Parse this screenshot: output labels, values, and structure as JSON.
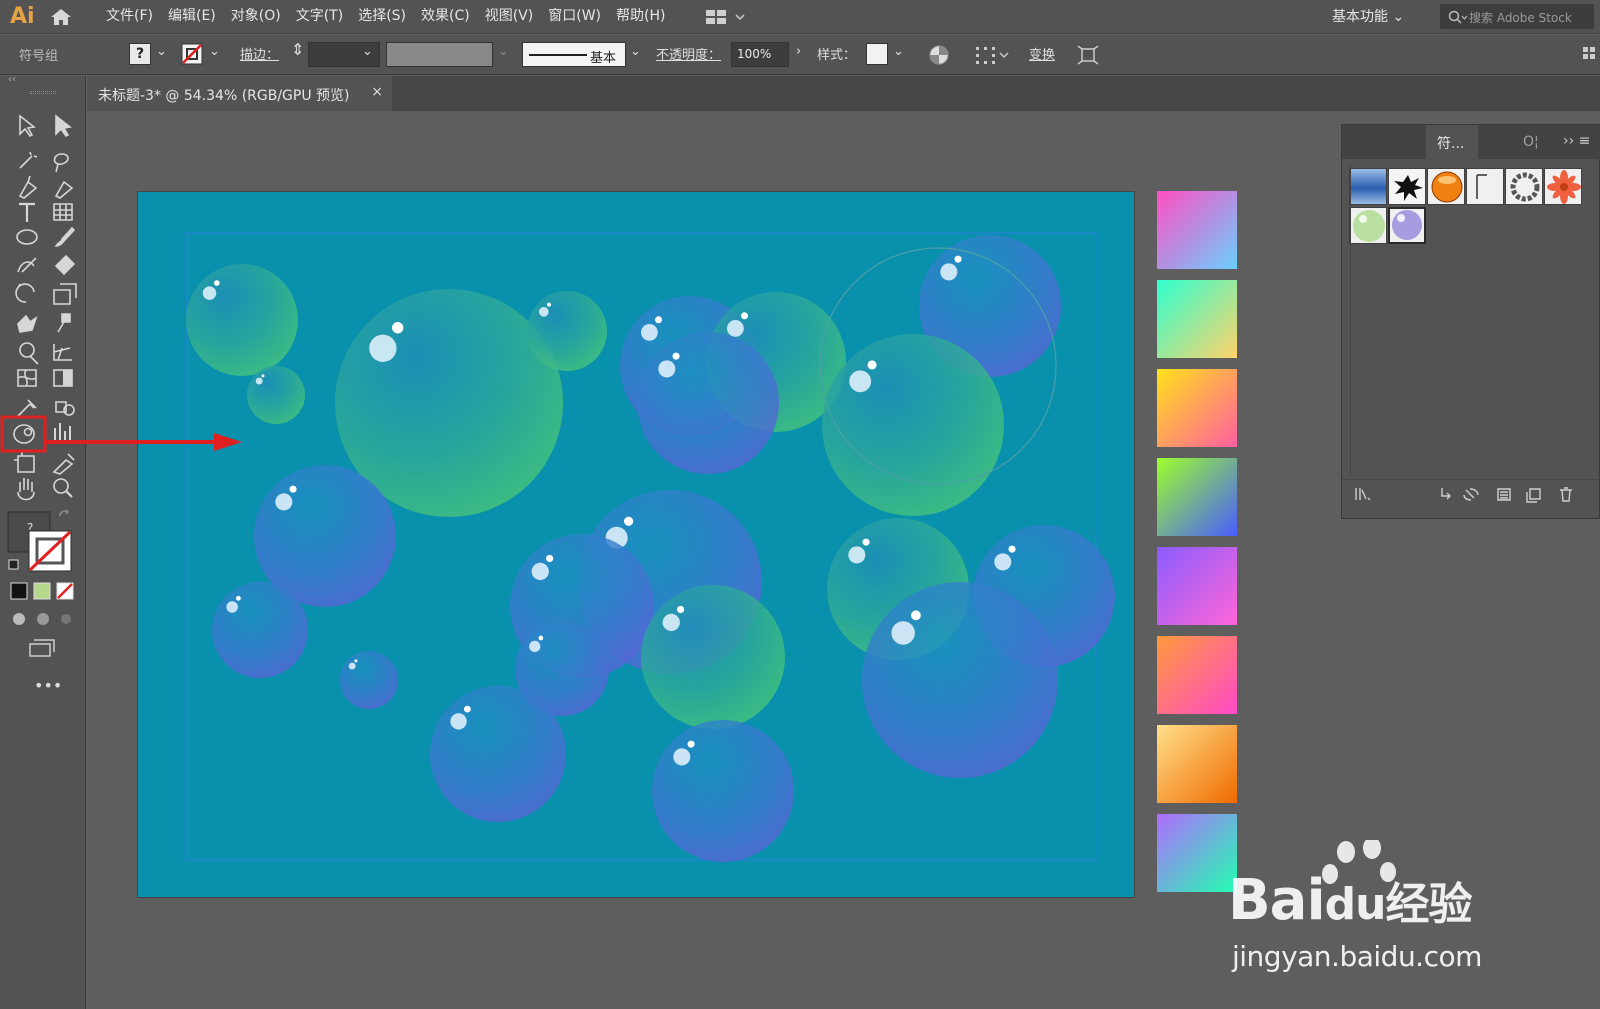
{
  "app": {
    "logo": "Ai"
  },
  "menu": {
    "items": [
      "文件(F)",
      "编辑(E)",
      "对象(O)",
      "文字(T)",
      "选择(S)",
      "效果(C)",
      "视图(V)",
      "窗口(W)",
      "帮助(H)"
    ],
    "workspace": "基本功能",
    "search_placeholder": "搜索 Adobe Stock"
  },
  "control": {
    "selection": "符号组",
    "stroke_label": "描边：",
    "stroke_profile": "基本",
    "opacity_label": "不透明度：",
    "opacity_value": "100%",
    "style_label": "样式：",
    "transform_label": "变换"
  },
  "document": {
    "tab_title": "未标题-3* @ 54.34% (RGB/GPU 预览)",
    "close_glyph": "×"
  },
  "panel": {
    "tab_symbols": "符...",
    "tab_other": "O¦",
    "menu_glyph": "›› ≡"
  },
  "colors": {
    "artboard": "#0990ad",
    "highlight_box": "#e02020",
    "arrow": "#e02020",
    "bubble_green": "#3bb878",
    "bubble_blue": "#4a72cf"
  },
  "swatches": [
    {
      "from": "#ff4ec2",
      "to": "#6ad0ff"
    },
    {
      "from": "#2fffd0",
      "to": "#ffd36a"
    },
    {
      "from": "#ffe21a",
      "to": "#ff5fa0"
    },
    {
      "from": "#9cff2a",
      "to": "#4a5cff"
    },
    {
      "from": "#8a5cff",
      "to": "#ff66d8"
    },
    {
      "from": "#ff9a3c",
      "to": "#ff49c8"
    },
    {
      "from": "#ffe08a",
      "to": "#f06a00"
    },
    {
      "from": "#b06cff",
      "to": "#22ffb0"
    }
  ],
  "watermark": {
    "brand_a": "Bai",
    "brand_b": "du",
    "brand_cn": "经验",
    "url": "jingyan.baidu.com"
  }
}
